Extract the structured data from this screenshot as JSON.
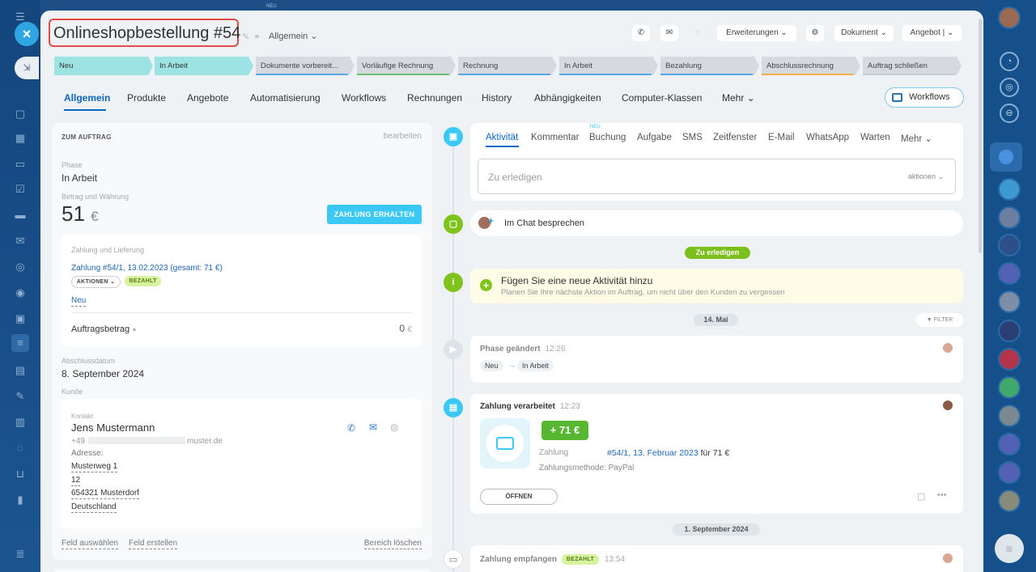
{
  "header": {
    "title": "Onlineshopbestellung #54",
    "category": "Allgemein",
    "top_badge": "NEU",
    "buttons": {
      "extensions": "Erweiterungen",
      "document": "Dokument",
      "offer": "Angebot"
    }
  },
  "stages": [
    {
      "label": "Neu",
      "state": "active",
      "color": "#9ee3e3"
    },
    {
      "label": "In Arbeit",
      "state": "active",
      "color": "#9ee3e3"
    },
    {
      "label": "Dokumente vorbereit...",
      "state": "grey",
      "color": "#5aa8e6"
    },
    {
      "label": "Vorläufige Rechnung",
      "state": "grey",
      "color": "#6cc070"
    },
    {
      "label": "Rechnung",
      "state": "grey",
      "color": "#5aa8e6"
    },
    {
      "label": "In Arbeit",
      "state": "grey",
      "color": "#5aa8e6"
    },
    {
      "label": "Bezahlung",
      "state": "grey",
      "color": "#5aa8e6"
    },
    {
      "label": "Abschlussrechnung",
      "state": "grey",
      "color": "#f0b04a"
    },
    {
      "label": "Auftrag schließen",
      "state": "grey",
      "color": "#c8cdd2"
    }
  ],
  "tabs": [
    "Allgemein",
    "Produkte",
    "Angebote",
    "Automatisierung",
    "Workflows",
    "Rechnungen",
    "History",
    "Abhängigkeiten",
    "Computer-Klassen",
    "Mehr"
  ],
  "workflows_button": "Workflows",
  "order": {
    "section_title": "ZUM AUFTRAG",
    "edit": "bearbeiten",
    "phase_label": "Phase",
    "phase_value": "In Arbeit",
    "amount_label": "Betrag und Währung",
    "amount_value": "51",
    "currency": "€",
    "pay_button": "ZAHLUNG ERHALTEN",
    "payment_delivery_label": "Zahlung und Lieferung",
    "payment_link": "Zahlung #54/1, 13.02.2023 (gesamt: 71 €)",
    "actions_pill": "AKTIONEN",
    "paid_pill": "BEZAHLT",
    "new_link": "Neu",
    "order_amount_label": "Auftragsbetrag",
    "order_amount_value": "0",
    "order_amount_currency": "€",
    "close_date_label": "Abschlussdatum",
    "close_date_value": "8. September 2024",
    "customer_label": "Kunde",
    "contact_label": "Kontakt",
    "contact_name": "Jens Mustermann",
    "phone_prefix": "+49",
    "email_suffix": "muster.de",
    "address_label": "Adresse:",
    "address_lines": [
      "Musterweg 1",
      "12",
      "654321 Musterdorf",
      "Deutschland"
    ],
    "footer": {
      "select_field": "Feld auswählen",
      "create_field": "Feld erstellen",
      "delete_area": "Bereich löschen"
    }
  },
  "activity_tabs": {
    "items": [
      "Aktivität",
      "Kommentar",
      "Buchung",
      "Aufgabe",
      "SMS",
      "Zeitfenster",
      "E-Mail",
      "WhatsApp",
      "Warten",
      "Mehr"
    ],
    "new_badge": "NEU"
  },
  "todo": {
    "placeholder": "Zu erledigen",
    "actions": "aktionen"
  },
  "chat": {
    "label": "Im Chat besprechen"
  },
  "todo_pill": "Zu erledigen",
  "hint": {
    "title": "Fügen Sie eine neue Aktivität hinzu",
    "subtitle": "Planen Sie Ihre nächste Aktion im Auftrag, um nicht über den Kunden zu vergessen"
  },
  "date1": "14. Mai",
  "filter": "FILTER",
  "phase_change": {
    "title": "Phase geändert",
    "time": "12:26",
    "from": "Neu",
    "to": "In Arbeit"
  },
  "payment_processed": {
    "title": "Zahlung verarbeitet",
    "time": "12:23",
    "amount_badge": "+ 71 €",
    "payment_label": "Zahlung",
    "payment_link": "#54/1, 13. Februar 2023",
    "payment_for": "für 71 €",
    "method": "Zahlungsmethode: PayPal",
    "open_button": "ÖFFNEN"
  },
  "date2": "1. September 2024",
  "payment_received": {
    "title": "Zahlung empfangen",
    "badge": "BEZAHLT",
    "time": "13:54"
  }
}
